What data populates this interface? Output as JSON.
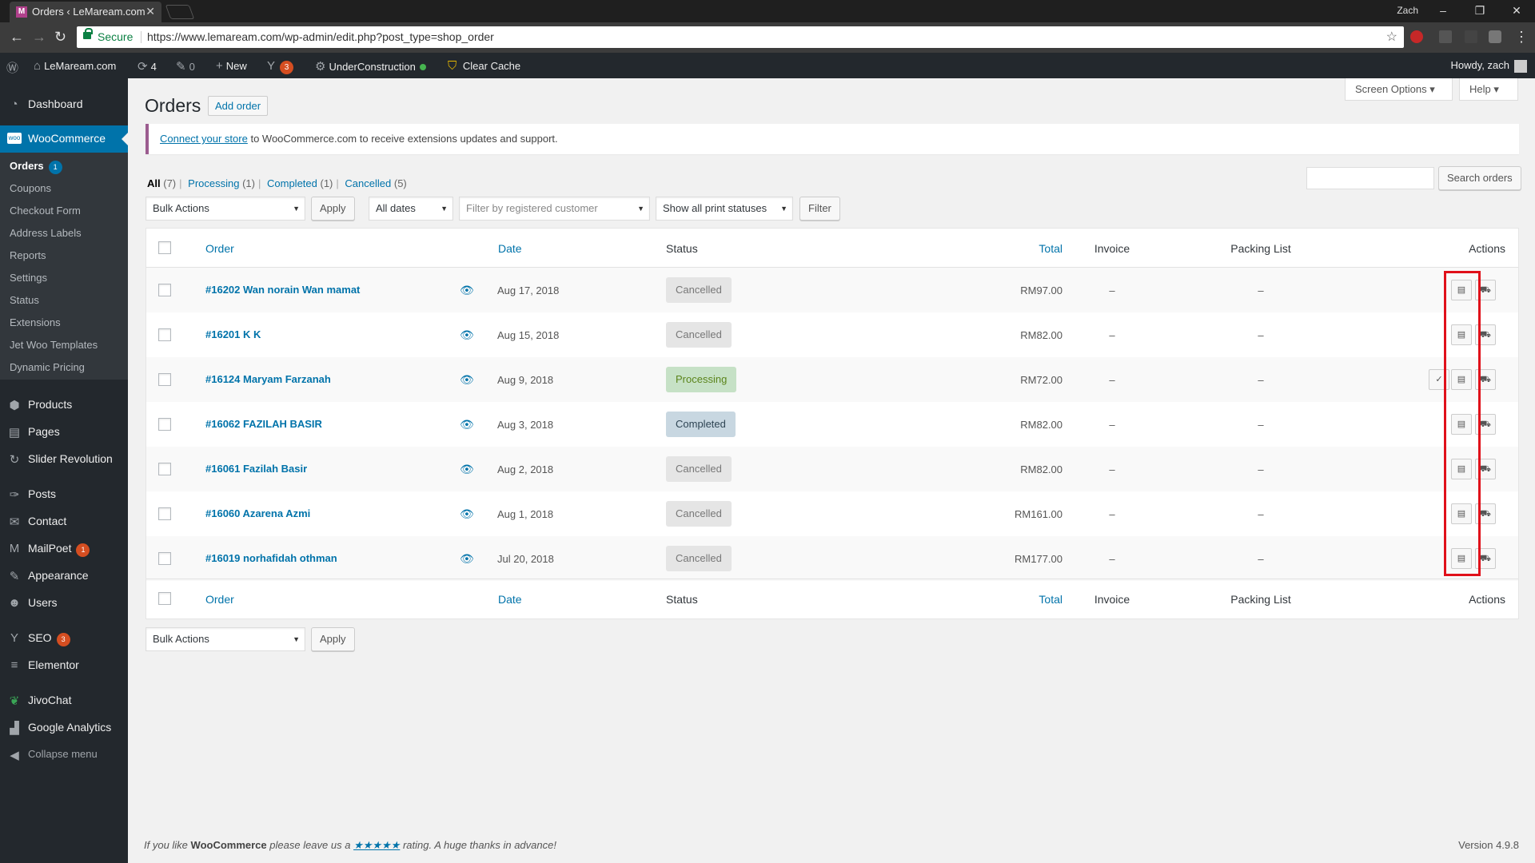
{
  "browser": {
    "tab_title": "Orders ‹ LeMaream.com",
    "tab_favicon": "M",
    "secure_label": "Secure",
    "url": "https://www.lemaream.com/wp-admin/edit.php?post_type=shop_order",
    "window_user": "Zach"
  },
  "adminbar": {
    "site_name": "LeMaream.com",
    "updates_count": "4",
    "comments_count": "0",
    "new_label": "New",
    "yoast_count": "3",
    "underconstruction_label": "UnderConstruction",
    "clear_cache_label": "Clear Cache",
    "howdy": "Howdy, zach"
  },
  "sidebar": {
    "dashboard": "Dashboard",
    "woocommerce": "WooCommerce",
    "woo_icon_label": "woo",
    "submenu": [
      {
        "label": "Orders",
        "badge": "1"
      },
      {
        "label": "Coupons"
      },
      {
        "label": "Checkout Form"
      },
      {
        "label": "Address Labels"
      },
      {
        "label": "Reports"
      },
      {
        "label": "Settings"
      },
      {
        "label": "Status"
      },
      {
        "label": "Extensions"
      },
      {
        "label": "Jet Woo Templates"
      },
      {
        "label": "Dynamic Pricing"
      }
    ],
    "menu": [
      {
        "label": "Products",
        "icon": "products-icon"
      },
      {
        "label": "Pages",
        "icon": "pages-icon"
      },
      {
        "label": "Slider Revolution",
        "icon": "slider-revolution-icon"
      },
      {
        "label": "Posts",
        "icon": "posts-icon"
      },
      {
        "label": "Contact",
        "icon": "contact-icon"
      },
      {
        "label": "MailPoet",
        "icon": "mailpoet-icon",
        "badge": "1"
      },
      {
        "label": "Appearance",
        "icon": "appearance-icon"
      },
      {
        "label": "Users",
        "icon": "users-icon"
      },
      {
        "label": "SEO",
        "icon": "yoast-seo-icon",
        "badge": "3"
      },
      {
        "label": "Elementor",
        "icon": "elementor-icon"
      },
      {
        "label": "JivoChat",
        "icon": "jivochat-icon"
      },
      {
        "label": "Google Analytics",
        "icon": "google-analytics-icon"
      }
    ],
    "collapse": "Collapse menu"
  },
  "header": {
    "screen_options": "Screen Options",
    "help": "Help",
    "title": "Orders",
    "add_order": "Add order"
  },
  "notice": {
    "link": "Connect your store",
    "text": " to WooCommerce.com to receive extensions updates and support."
  },
  "filters": {
    "all": "All",
    "all_count": "(7)",
    "processing": "Processing",
    "processing_count": "(1)",
    "completed": "Completed",
    "completed_count": "(1)",
    "cancelled": "Cancelled",
    "cancelled_count": "(5)",
    "search_button": "Search orders",
    "bulk_actions": "Bulk Actions",
    "apply": "Apply",
    "all_dates": "All dates",
    "customer_placeholder": "Filter by registered customer",
    "print_status": "Show all print statuses",
    "filter": "Filter"
  },
  "table": {
    "columns": {
      "order": "Order",
      "date": "Date",
      "status": "Status",
      "total": "Total",
      "invoice": "Invoice",
      "packing": "Packing List",
      "actions": "Actions"
    },
    "rows": [
      {
        "order": "#16202 Wan norain Wan mamat",
        "date": "Aug 17, 2018",
        "status": "Cancelled",
        "status_key": "cancelled",
        "total": "RM97.00",
        "invoice": "–",
        "packing": "–"
      },
      {
        "order": "#16201 K K",
        "date": "Aug 15, 2018",
        "status": "Cancelled",
        "status_key": "cancelled",
        "total": "RM82.00",
        "invoice": "–",
        "packing": "–"
      },
      {
        "order": "#16124 Maryam Farzanah",
        "date": "Aug 9, 2018",
        "status": "Processing",
        "status_key": "processing",
        "total": "RM72.00",
        "invoice": "–",
        "packing": "–"
      },
      {
        "order": "#16062 FAZILAH BASIR",
        "date": "Aug 3, 2018",
        "status": "Completed",
        "status_key": "completed",
        "total": "RM82.00",
        "invoice": "–",
        "packing": "–"
      },
      {
        "order": "#16061 Fazilah Basir",
        "date": "Aug 2, 2018",
        "status": "Cancelled",
        "status_key": "cancelled",
        "total": "RM82.00",
        "invoice": "–",
        "packing": "–"
      },
      {
        "order": "#16060 Azarena Azmi",
        "date": "Aug 1, 2018",
        "status": "Cancelled",
        "status_key": "cancelled",
        "total": "RM161.00",
        "invoice": "–",
        "packing": "–"
      },
      {
        "order": "#16019 norhafidah othman",
        "date": "Jul 20, 2018",
        "status": "Cancelled",
        "status_key": "cancelled",
        "total": "RM177.00",
        "invoice": "–",
        "packing": "–"
      }
    ]
  },
  "bottom_bulk": {
    "bulk_actions": "Bulk Actions",
    "apply": "Apply"
  },
  "footer": {
    "prefix": "If you like ",
    "brand": "WooCommerce",
    "mid": " please leave us a ",
    "stars": "★★★★★",
    "suffix": " rating. A huge thanks in advance!",
    "version": "Version 4.9.8"
  },
  "colors": {
    "accent": "#0073aa",
    "admin_dark": "#23282d",
    "woo_purple": "#9b5c8f",
    "highlight_red": "#e0101a",
    "processing_bg": "#c6e1c6",
    "completed_bg": "#c8d7e1",
    "cancelled_bg": "#e5e5e5"
  }
}
